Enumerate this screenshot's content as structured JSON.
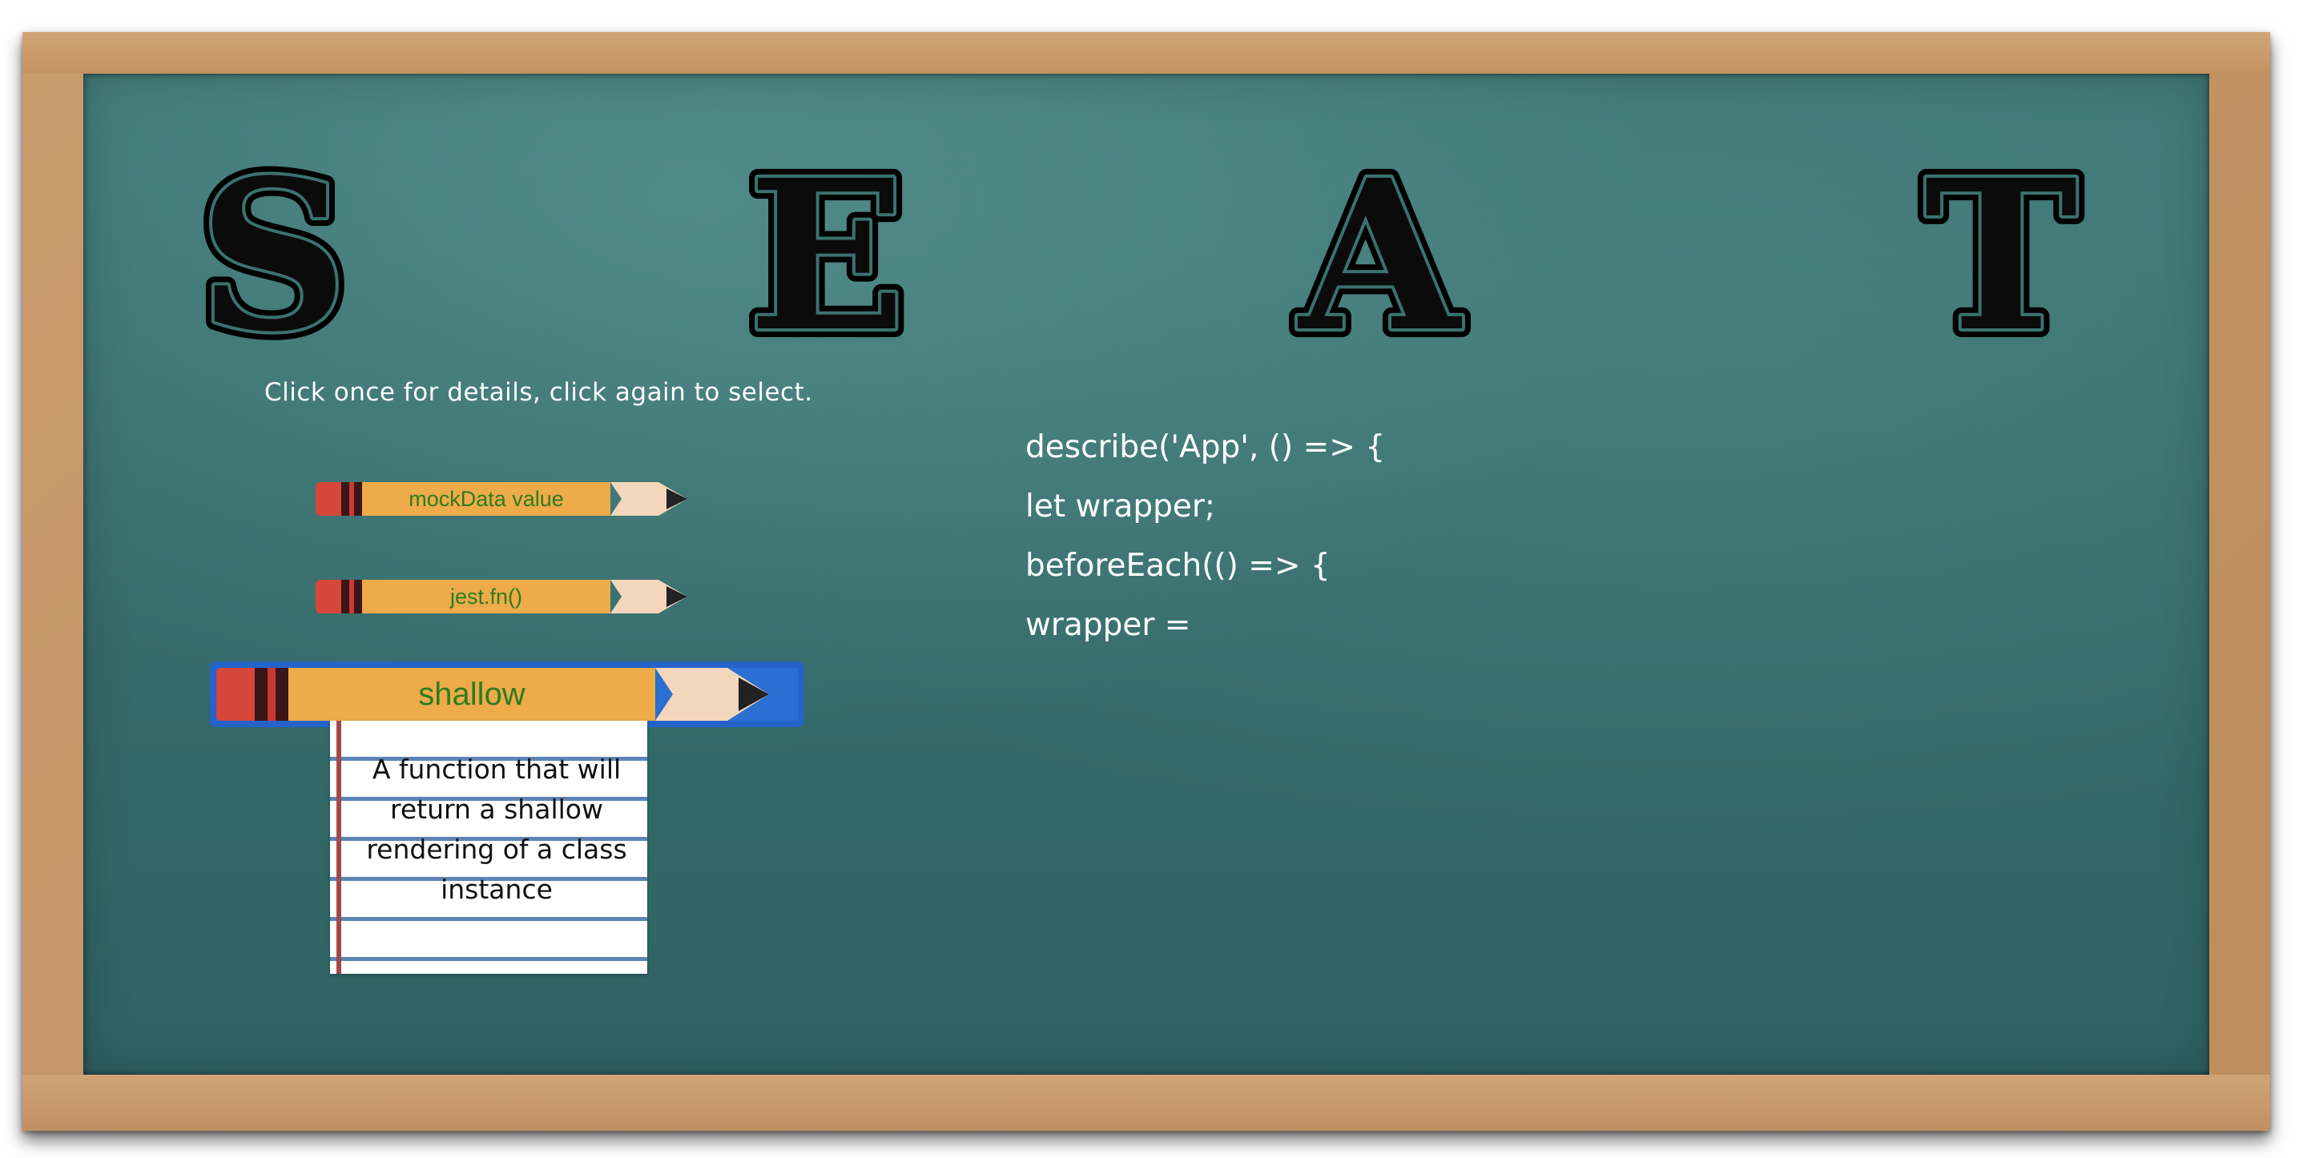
{
  "title_letters": [
    "S",
    "E",
    "A",
    "T"
  ],
  "instructions": "Click once for details, click again to select.",
  "options": [
    {
      "label": "mockData value",
      "selected": false
    },
    {
      "label": "jest.fn()",
      "selected": false
    },
    {
      "label": "shallow",
      "selected": true
    }
  ],
  "details": {
    "text": "A function that will return a shallow rendering of a class instance"
  },
  "code_lines": [
    "describe('App', () => {",
    "let wrapper;",
    "beforeEach(() => {",
    "wrapper ="
  ],
  "colors": {
    "board": "#356b6a",
    "frame": "#c49566",
    "pencil_body": "#edab4a",
    "pencil_text": "#2e7b1f",
    "selection": "#2563c9"
  }
}
